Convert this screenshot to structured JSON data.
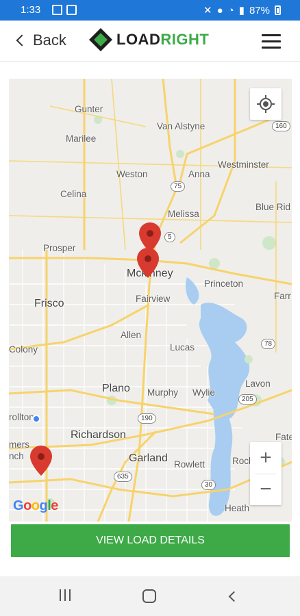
{
  "status_bar": {
    "time": "1:33",
    "battery": "87%"
  },
  "header": {
    "back_label": "Back",
    "logo_part1": "LOAD",
    "logo_part2": "RIGHT"
  },
  "map": {
    "places": [
      "Gunter",
      "Van Alstyne",
      "Marilee",
      "Weston",
      "Anna",
      "Westminster",
      "Celina",
      "Melissa",
      "Blue Rid",
      "Prosper",
      "Mckinney",
      "Princeton",
      "Frisco",
      "Fairview",
      "Farr",
      "Allen",
      "Lucas",
      "Colony",
      "Plano",
      "Murphy",
      "Wylie",
      "Lavon",
      "rollton",
      "Richardson",
      "Fate",
      "mers",
      "nch",
      "Garland",
      "Rowlett",
      "Rockw",
      "Heath"
    ],
    "road_shields": [
      "160",
      "75",
      "5",
      "78",
      "205",
      "190",
      "635",
      "30"
    ],
    "attribution": "Google",
    "zoom_in": "+",
    "zoom_out": "−"
  },
  "actions": {
    "view_details": "VIEW LOAD DETAILS"
  },
  "colors": {
    "accent": "#3daa47",
    "status_bar": "#1f78d8",
    "pin": "#d93a2f"
  }
}
